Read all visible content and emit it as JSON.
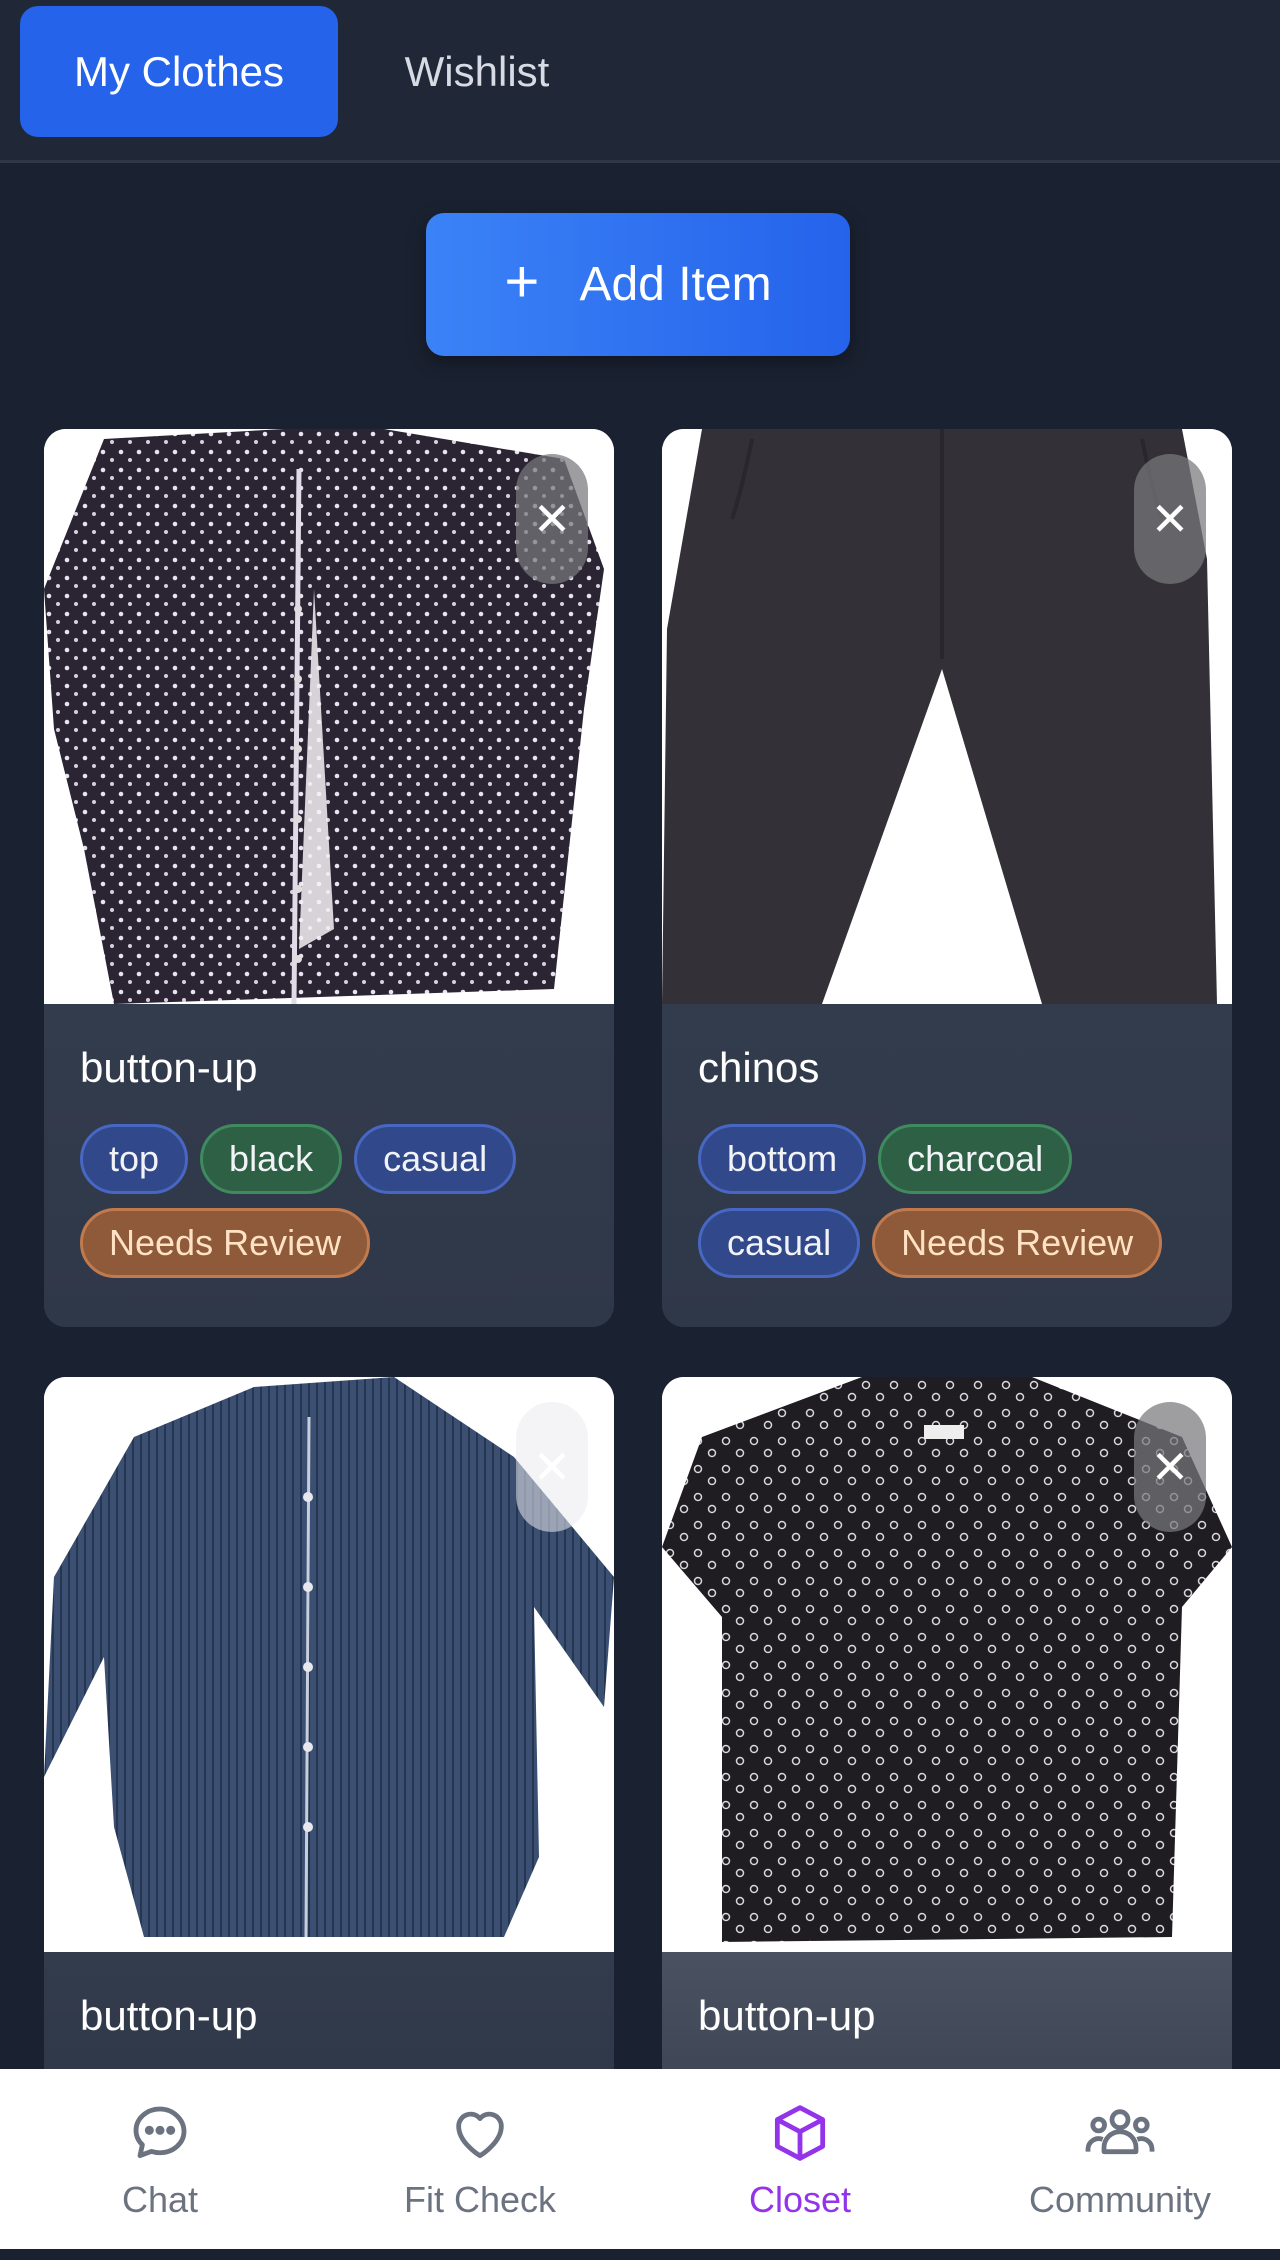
{
  "tabs": {
    "my_clothes": "My Clothes",
    "wishlist": "Wishlist"
  },
  "add_button": {
    "icon": "plus-icon",
    "label": "Add Item"
  },
  "items": [
    {
      "name": "button-up",
      "tags": [
        "top",
        "black",
        "casual",
        "Needs Review"
      ]
    },
    {
      "name": "chinos",
      "tags": [
        "bottom",
        "charcoal",
        "casual",
        "Needs Review"
      ]
    },
    {
      "name": "button-up",
      "tags": []
    },
    {
      "name": "button-up",
      "tags": []
    }
  ],
  "nav": {
    "chat": "Chat",
    "fit_check": "Fit Check",
    "closet": "Closet",
    "community": "Community",
    "active": "Closet"
  },
  "colors": {
    "background": "#1a2130",
    "accent_blue": "#2563eb",
    "active_nav": "#9333ea",
    "needs_review": "#8e5a3a"
  }
}
